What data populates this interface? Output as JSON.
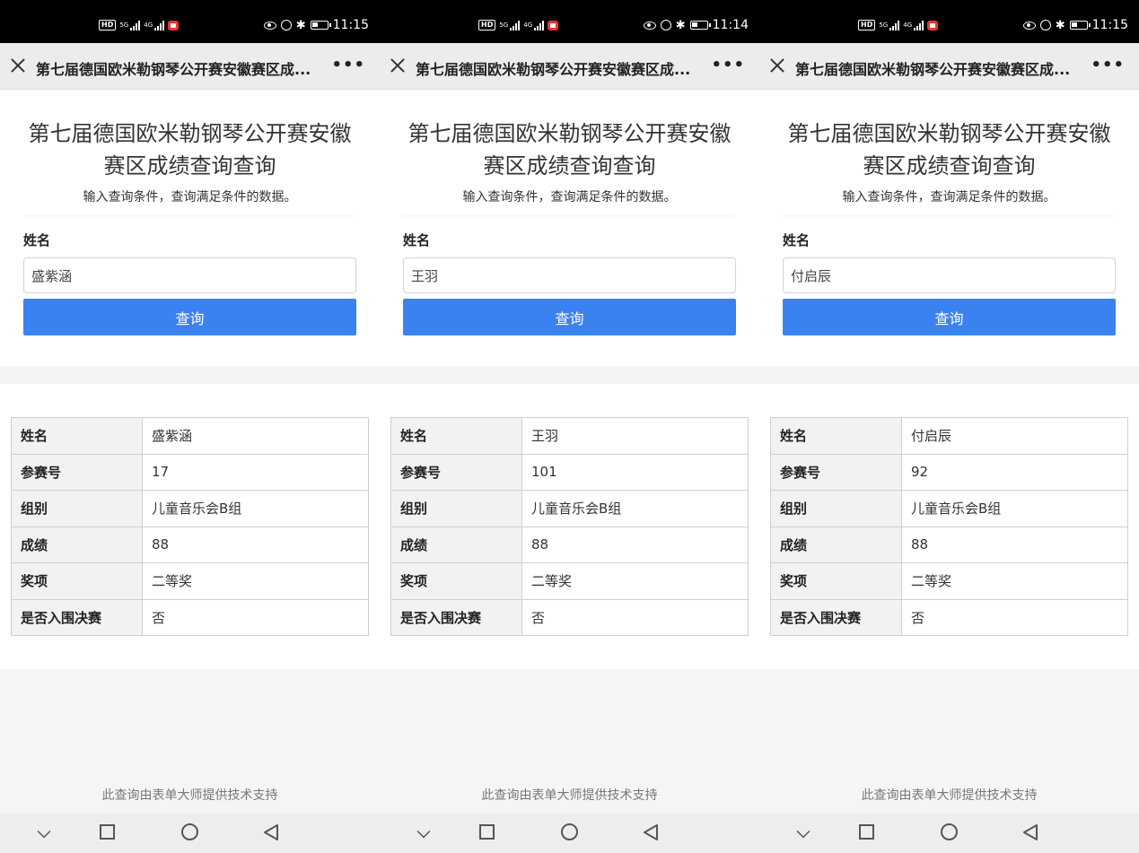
{
  "page_title": "第七届德国欧米勒钢琴公开赛安徽赛区成...",
  "heading": "第七届德国欧米勒钢琴公开赛安徽赛区成绩查询查询",
  "subtitle": "输入查询条件，查询满足条件的数据。",
  "field_label": "姓名",
  "button_label": "查询",
  "more_label": "•••",
  "footer": "此查询由表单大师提供技术支持",
  "status_signal_label": "5G",
  "status_signal_label2": "4G",
  "row_labels": [
    "姓名",
    "参赛号",
    "组别",
    "成绩",
    "奖项",
    "是否入围决赛"
  ],
  "screens": [
    {
      "time": "11:15",
      "query_value": "盛紫涵",
      "result": [
        "盛紫涵",
        "17",
        "儿童音乐会B组",
        "88",
        "二等奖",
        "否"
      ]
    },
    {
      "time": "11:14",
      "query_value": "王羽",
      "result": [
        "王羽",
        "101",
        "儿童音乐会B组",
        "88",
        "二等奖",
        "否"
      ]
    },
    {
      "time": "11:15",
      "query_value": "付启辰",
      "result": [
        "付启辰",
        "92",
        "儿童音乐会B组",
        "88",
        "二等奖",
        "否"
      ]
    }
  ]
}
